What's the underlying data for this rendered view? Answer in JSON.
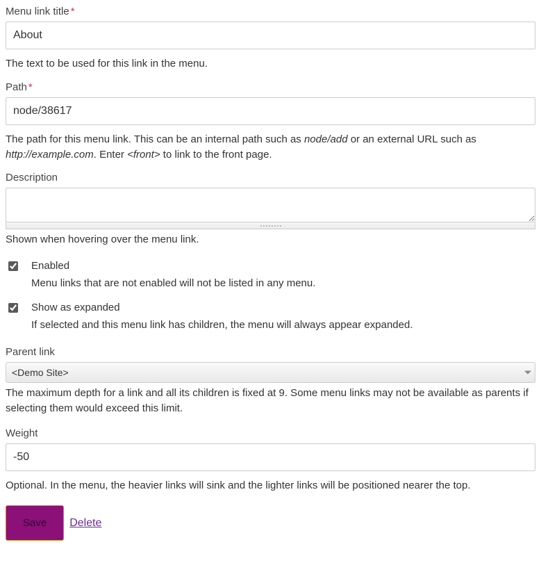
{
  "title_field": {
    "label": "Menu link title",
    "value": "About",
    "help": "The text to be used for this link in the menu."
  },
  "path_field": {
    "label": "Path",
    "value": "node/38617",
    "help_prefix": "The path for this menu link. This can be an internal path such as ",
    "help_em1": "node/add",
    "help_mid": " or an external URL such as ",
    "help_em2": "http://example.com",
    "help_suffix1": ". Enter ",
    "help_em3": "<front>",
    "help_suffix2": " to link to the front page."
  },
  "description_field": {
    "label": "Description",
    "value": "",
    "help": "Shown when hovering over the menu link."
  },
  "enabled_checkbox": {
    "label": "Enabled",
    "checked": true,
    "help": "Menu links that are not enabled will not be listed in any menu."
  },
  "expanded_checkbox": {
    "label": "Show as expanded",
    "checked": true,
    "help": "If selected and this menu link has children, the menu will always appear expanded."
  },
  "parent_link": {
    "label": "Parent link",
    "selected": "<Demo Site>",
    "help": "The maximum depth for a link and all its children is fixed at 9. Some menu links may not be available as parents if selecting them would exceed this limit."
  },
  "weight_field": {
    "label": "Weight",
    "value": "-50",
    "help": "Optional. In the menu, the heavier links will sink and the lighter links will be positioned nearer the top."
  },
  "actions": {
    "save": "Save",
    "delete": "Delete"
  }
}
